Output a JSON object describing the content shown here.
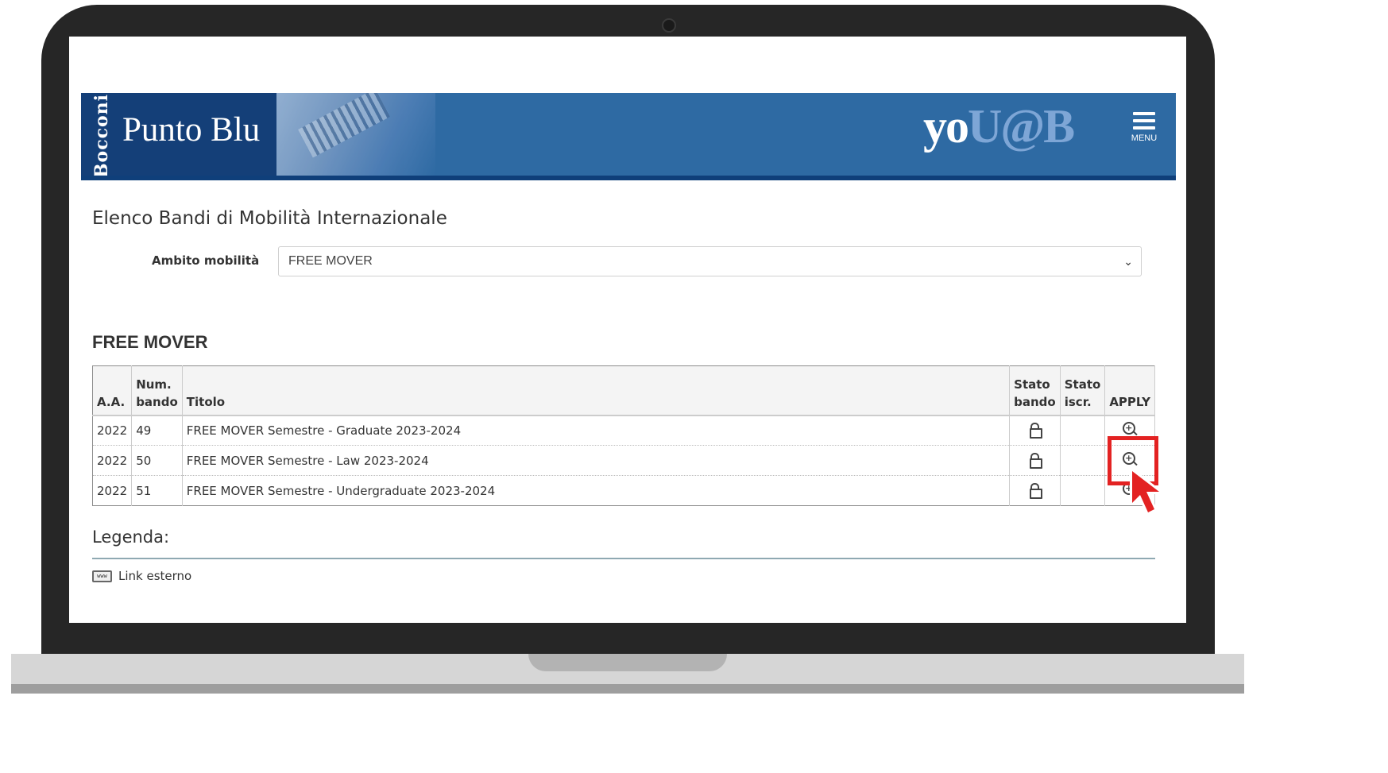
{
  "header": {
    "brand_vertical": "Bocconi",
    "brand_title": "Punto Blu",
    "logo_yo": "yo",
    "logo_uab": "U@B",
    "menu_label": "MENU",
    "icon_menu": "hamburger-icon"
  },
  "page": {
    "title": "Elenco Bandi di Mobilità Internazionale",
    "ambito_label": "Ambito mobilità",
    "ambito_value": "FREE MOVER",
    "section_title": "FREE MOVER"
  },
  "table": {
    "headers": {
      "aa": "A.A.",
      "num_bando_line1": "Num.",
      "num_bando_line2": "bando",
      "titolo": "Titolo",
      "stato_bando_line1": "Stato",
      "stato_bando_line2": "bando",
      "stato_iscr_line1": "Stato",
      "stato_iscr_line2": "iscr.",
      "apply": "APPLY"
    },
    "rows": [
      {
        "aa": "2022",
        "num": "49",
        "titolo": "FREE MOVER Semestre - Graduate 2023-2024",
        "stato_bando_icon": "unlock-icon",
        "apply_icon": "zoom-in-icon"
      },
      {
        "aa": "2022",
        "num": "50",
        "titolo": "FREE MOVER Semestre - Law 2023-2024",
        "stato_bando_icon": "unlock-icon",
        "apply_icon": "zoom-in-icon"
      },
      {
        "aa": "2022",
        "num": "51",
        "titolo": "FREE MOVER Semestre - Undergraduate 2023-2024",
        "stato_bando_icon": "unlock-icon",
        "apply_icon": "zoom-in-icon"
      }
    ]
  },
  "legend": {
    "title": "Legenda:",
    "items": [
      {
        "icon": "www-icon",
        "label": "Link esterno"
      }
    ]
  },
  "colors": {
    "banner": "#2e6aa3",
    "brand_block": "#143f78",
    "highlight": "#e32222"
  }
}
